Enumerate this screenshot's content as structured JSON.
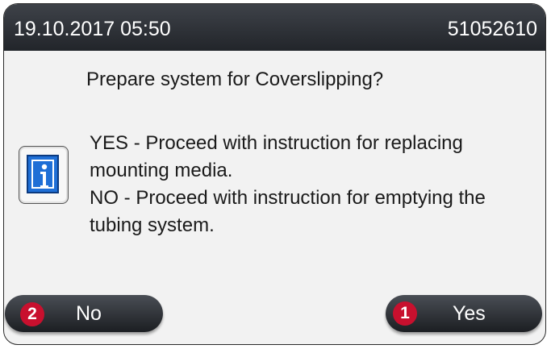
{
  "titlebar": {
    "datetime": "19.10.2017 05:50",
    "serial": "51052610"
  },
  "dialog": {
    "question": "Prepare system for Coverslipping?",
    "lines": [
      "YES - Proceed with instruction for replacing",
      "mounting media.",
      "NO - Proceed with instruction for emptying the",
      "tubing system."
    ],
    "icon": "info-icon"
  },
  "buttons": {
    "no_label": "No",
    "yes_label": "Yes"
  },
  "callouts": {
    "no_number": "2",
    "yes_number": "1"
  },
  "colors": {
    "titlebar": "#2d3036",
    "button": "#33363c",
    "info_blue": "#1f6fd6",
    "callout_red": "#c8102e"
  }
}
